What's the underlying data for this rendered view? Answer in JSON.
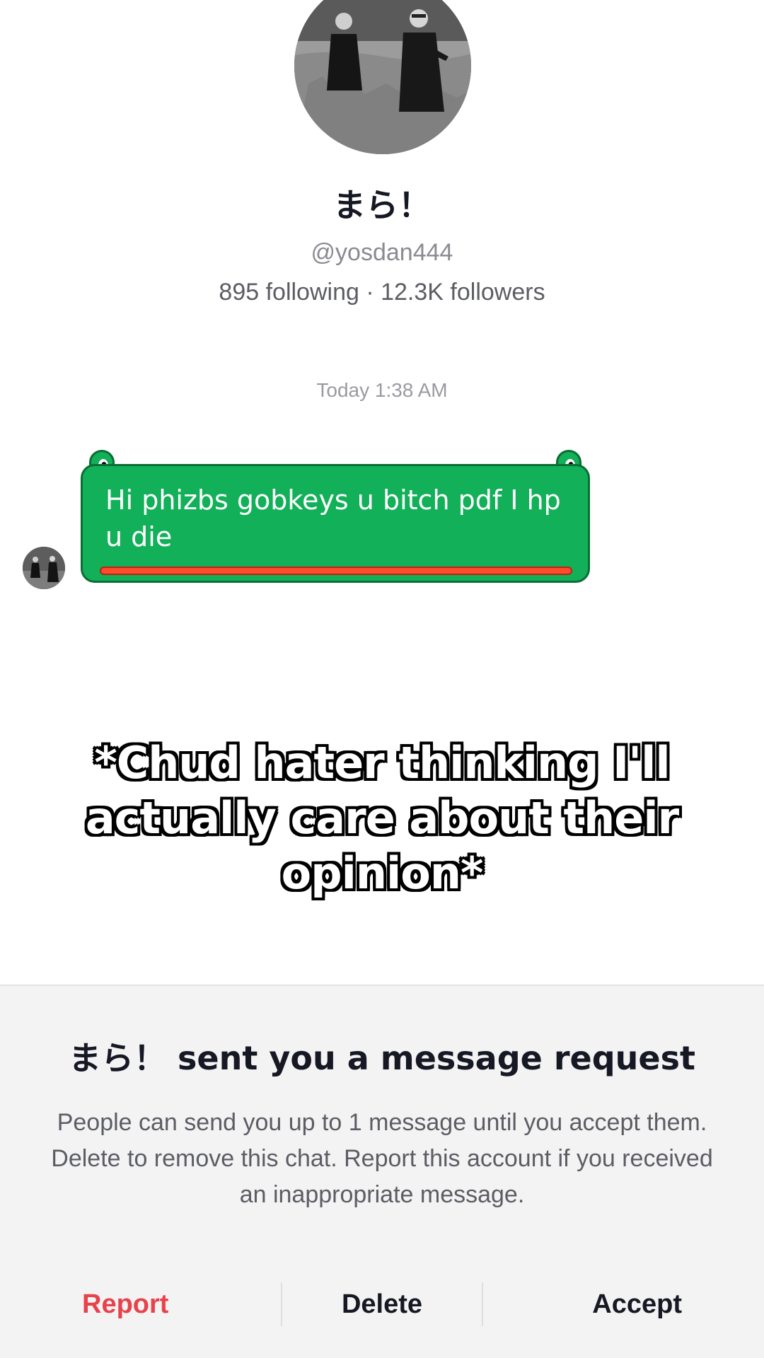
{
  "profile": {
    "display_name": "まら！",
    "username": "@yosdan444",
    "stats": "895 following · 12.3K followers",
    "avatar_icon": "profile-photo-icon"
  },
  "chat": {
    "timestamp": "Today 1:38 AM",
    "message": {
      "text": "Hi phizbs gobkeys u bitch pdf I hp u die",
      "bubble_color": "#12b058",
      "underline_color": "#ff4a2e"
    }
  },
  "overlay_caption": "*Chud hater thinking I'll actually care about their opinion*",
  "request": {
    "title": "まら！ sent you a message request",
    "body": "People can send you up to 1 message until you accept them. Delete to remove this chat. Report this account if you received an inappropriate message.",
    "report_label": "Report",
    "delete_label": "Delete",
    "accept_label": "Accept",
    "report_color": "#e8424b"
  }
}
